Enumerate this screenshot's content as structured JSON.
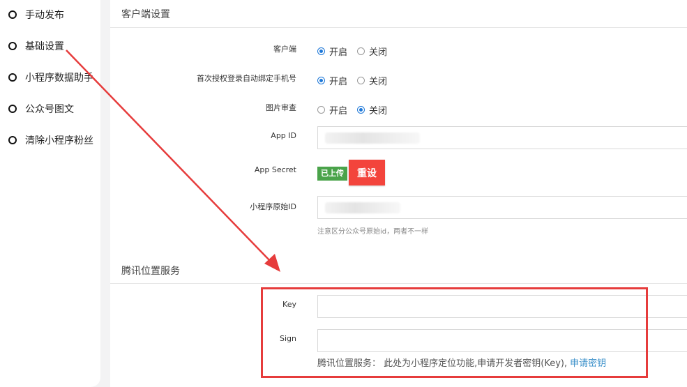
{
  "sidebar": {
    "items": [
      {
        "label": "手动发布"
      },
      {
        "label": "基础设置"
      },
      {
        "label": "小程序数据助手"
      },
      {
        "label": "公众号图文"
      },
      {
        "label": "清除小程序粉丝"
      }
    ]
  },
  "client_settings": {
    "title": "客户端设置",
    "client": {
      "label": "客户端",
      "options": [
        "开启",
        "关闭"
      ],
      "selected": "开启"
    },
    "bind_phone": {
      "label": "首次授权登录自动绑定手机号",
      "options": [
        "开启",
        "关闭"
      ],
      "selected": "开启"
    },
    "image_review": {
      "label": "图片审查",
      "options": [
        "开启",
        "关闭"
      ],
      "selected": "关闭"
    },
    "app_id": {
      "label": "App ID",
      "value": ""
    },
    "app_secret": {
      "label": "App Secret",
      "status_badge": "已上传",
      "reset_label": "重设"
    },
    "original_id": {
      "label": "小程序原始ID",
      "value": "",
      "hint": "注意区分公众号原始id，两者不一样"
    }
  },
  "tencent_location": {
    "title": "腾讯位置服务",
    "key": {
      "label": "Key",
      "value": ""
    },
    "sign": {
      "label": "Sign",
      "value": ""
    },
    "help_text": "腾讯位置服务：  此处为小程序定位功能,申请开发者密钥(Key),",
    "help_link": "申请密钥"
  },
  "annotation": {
    "color": "#e63c3c"
  }
}
